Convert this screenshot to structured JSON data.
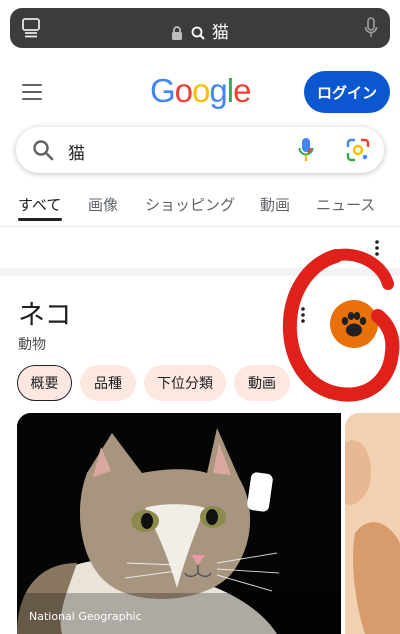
{
  "browser": {
    "address_text": "猫"
  },
  "header": {
    "logo_letters": [
      "G",
      "o",
      "o",
      "g",
      "l",
      "e"
    ],
    "logo_colors": [
      "#4285F4",
      "#EA4335",
      "#FBBC05",
      "#4285F4",
      "#34A853",
      "#EA4335"
    ],
    "login_label": "ログイン"
  },
  "search": {
    "query": "猫"
  },
  "tabs": [
    {
      "label": "すべて",
      "active": true
    },
    {
      "label": "画像"
    },
    {
      "label": "ショッピング"
    },
    {
      "label": "動画"
    },
    {
      "label": "ニュース"
    }
  ],
  "knowledge_panel": {
    "title": "ネコ",
    "subtitle": "動物",
    "chips": [
      "概要",
      "品種",
      "下位分類",
      "動画"
    ],
    "image_credit": "National Geographic",
    "accent_color": "#e8710a"
  },
  "colors": {
    "annotation": "#e0201a",
    "login_bg": "#0b57d0"
  }
}
